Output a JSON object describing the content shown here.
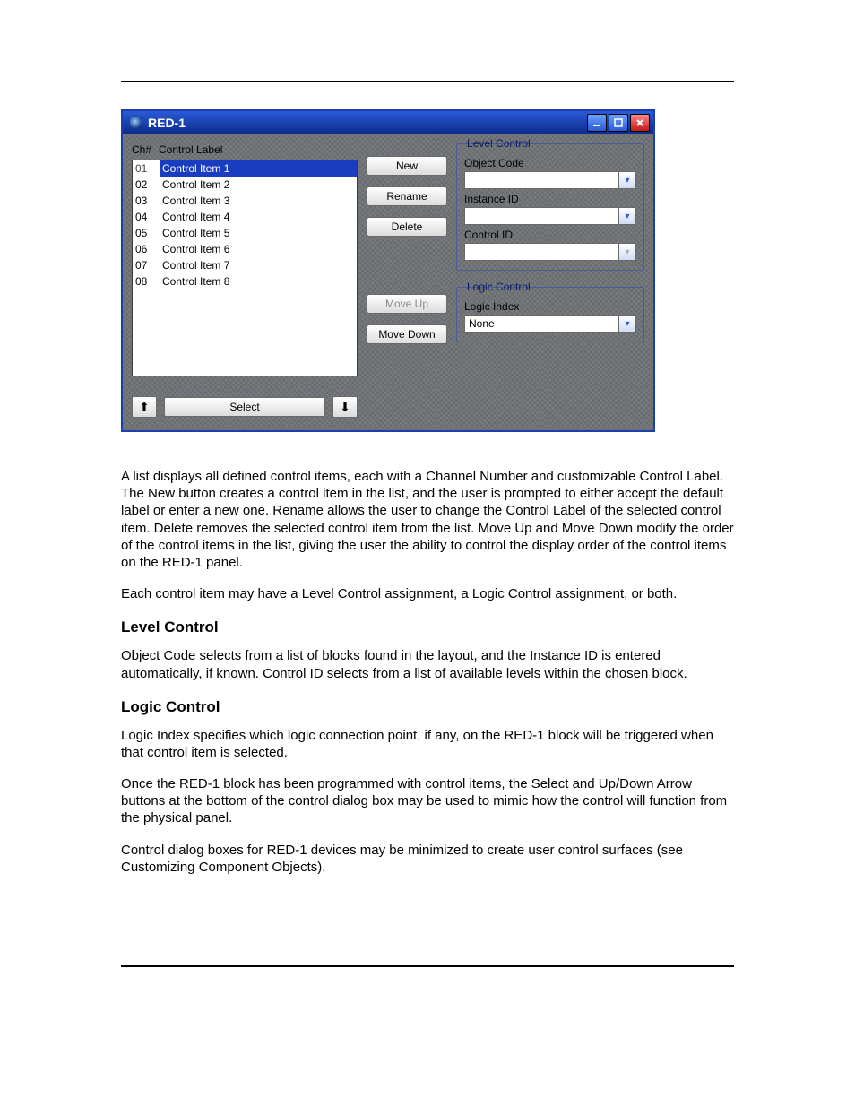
{
  "window": {
    "title": "RED-1",
    "list": {
      "header_ch": "Ch#",
      "header_label": "Control Label",
      "rows": [
        {
          "ch": "01",
          "label": "Control Item 1",
          "selected": true
        },
        {
          "ch": "02",
          "label": "Control Item 2",
          "selected": false
        },
        {
          "ch": "03",
          "label": "Control Item 3",
          "selected": false
        },
        {
          "ch": "04",
          "label": "Control Item 4",
          "selected": false
        },
        {
          "ch": "05",
          "label": "Control Item 5",
          "selected": false
        },
        {
          "ch": "06",
          "label": "Control Item 6",
          "selected": false
        },
        {
          "ch": "07",
          "label": "Control Item 7",
          "selected": false
        },
        {
          "ch": "08",
          "label": "Control Item 8",
          "selected": false
        }
      ]
    },
    "buttons": {
      "new": "New",
      "rename": "Rename",
      "delete": "Delete",
      "moveup": "Move Up",
      "movedown": "Move Down",
      "select": "Select"
    },
    "level_control": {
      "title": "Level Control",
      "object_code_label": "Object Code",
      "object_code_value": "",
      "instance_id_label": "Instance ID",
      "instance_id_value": "",
      "control_id_label": "Control ID",
      "control_id_value": ""
    },
    "logic_control": {
      "title": "Logic Control",
      "logic_index_label": "Logic Index",
      "logic_index_value": "None"
    }
  },
  "doc": {
    "p1": "A list displays all defined control items, each with a Channel Number and customizable Control Label. The New button creates a control item in the list, and the user is prompted to either accept the default label or enter a new one. Rename allows the user to change the Control Label of the selected control item. Delete removes the selected control item from the list. Move Up and Move Down modify the order of the control items in the list, giving the user the ability to control the display order of the control items on the RED-1 panel.",
    "p2": "Each control item may have a Level Control assignment, a Logic Control assignment, or both.",
    "h_level": "Level Control",
    "p3": "Object Code selects from a list of blocks found in the layout, and the Instance ID is entered automatically, if known. Control ID selects from a list of available levels within the chosen block.",
    "h_logic": "Logic Control",
    "p4": "Logic Index specifies which logic connection point, if any, on the RED-1 block will be triggered when that control item is selected.",
    "p5": "Once the RED-1 block has been programmed with control items, the Select and Up/Down Arrow buttons at the bottom of the control dialog box may be used to mimic how the control will function from the physical panel.",
    "p6": "Control dialog boxes for RED-1 devices may be minimized to create user control surfaces (see Customizing Component Objects)."
  }
}
